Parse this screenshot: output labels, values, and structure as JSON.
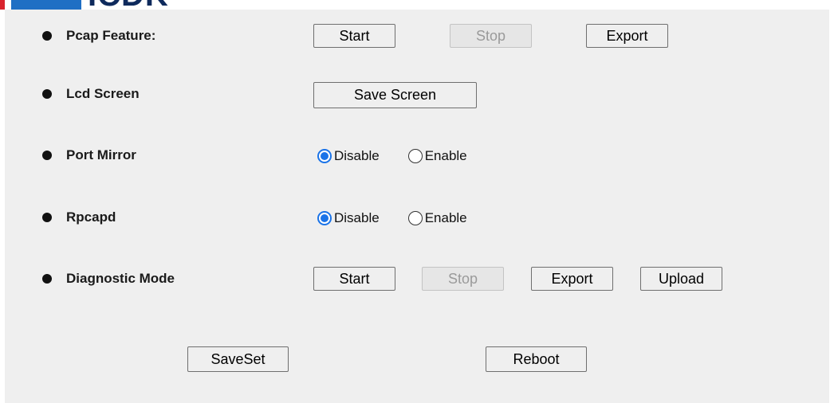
{
  "logo": {
    "text": "ICDK"
  },
  "rows": [
    {
      "label": "Pcap Feature:",
      "buttons": [
        "Start",
        "Stop",
        "Export"
      ]
    },
    {
      "label": "Lcd Screen",
      "buttons": [
        "Save Screen"
      ]
    },
    {
      "label": "Port Mirror",
      "radios": [
        "Disable",
        "Enable"
      ],
      "selected": "Disable"
    },
    {
      "label": "Rpcapd",
      "radios": [
        "Disable",
        "Enable"
      ],
      "selected": "Disable"
    },
    {
      "label": "Diagnostic Mode",
      "buttons": [
        "Start",
        "Stop",
        "Export",
        "Upload"
      ]
    }
  ],
  "disabled_buttons": [
    "Pcap Feature: Stop",
    "Diagnostic Mode Stop"
  ],
  "footer": {
    "saveset": "SaveSet",
    "reboot": "Reboot"
  },
  "colors": {
    "accent": "#1a73e8",
    "panel": "#efefef"
  }
}
